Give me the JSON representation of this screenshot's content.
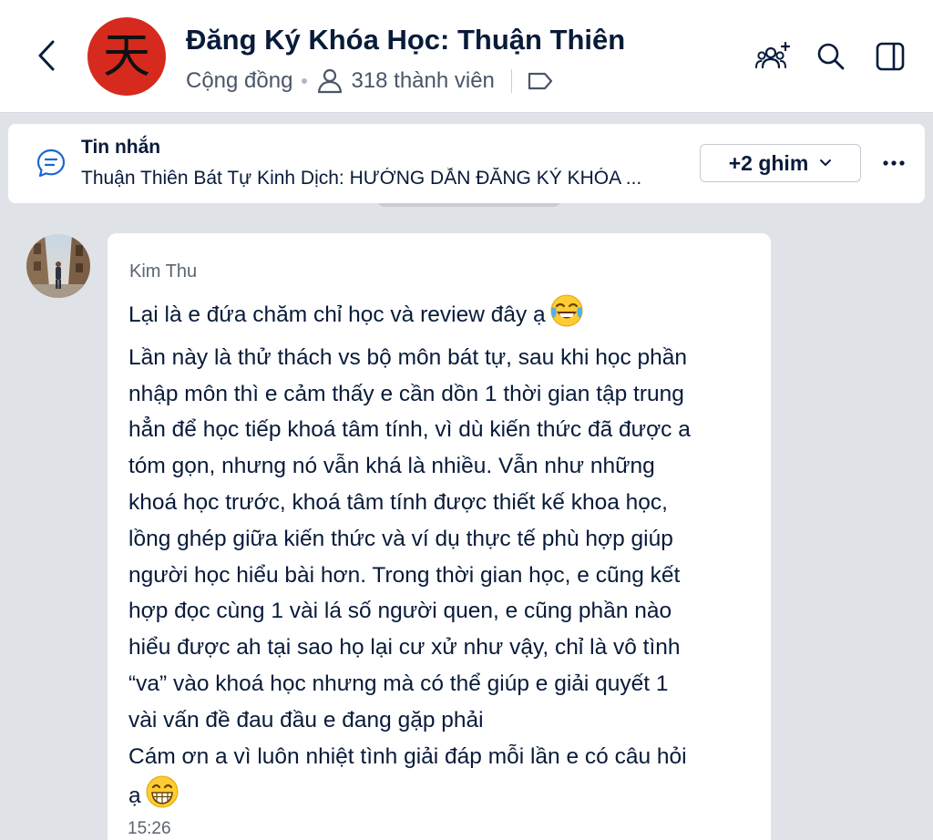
{
  "header": {
    "logo_char": "天",
    "title": "Đăng Ký Khóa Học: Thuận Thiên",
    "community_label": "Cộng đồng",
    "member_count": "318 thành viên",
    "icons": [
      "back-chevron-icon",
      "add-members-icon",
      "search-icon",
      "sidebar-toggle-icon",
      "tag-icon",
      "person-icon"
    ]
  },
  "pinned": {
    "title": "Tin nhắn",
    "text": "Thuận Thiên Bát Tự Kinh Dịch: HƯỚNG DẪN ĐĂNG KÝ KHÓA ...",
    "pins_button": "+2 ghim",
    "more_icon": "more-horizontal-icon"
  },
  "message": {
    "sender": "Kim Thu",
    "lines": [
      "Lại là e đứa chăm chỉ học và review đây ạ",
      "Lần này là thử thách vs bộ môn bát tự, sau khi học phần",
      "nhập môn thì e cảm thấy e cần dồn 1 thời gian tập trung",
      "hẳn để học tiếp khoá tâm tính, vì dù kiến thức đã được a",
      "tóm gọn, nhưng nó vẫn khá là nhiều. Vẫn như những",
      "khoá học trước, khoá tâm tính được thiết kế khoa học,",
      "lồng ghép giữa kiến thức và ví dụ thực tế phù hợp giúp",
      "người học hiểu bài hơn. Trong thời gian học, e cũng kết",
      "hợp đọc cùng 1 vài lá số người quen, e cũng phần nào",
      "hiểu được ah tại sao họ lại cư xử như vậy, chỉ là vô tình",
      "“va” vào khoá học nhưng mà có thể giúp e giải quyết 1",
      "vài vấn đề đau đầu e đang gặp phải",
      "Cám ơn a vì luôn nhiệt tình giải đáp mỗi lần e có câu hỏi",
      "ạ"
    ],
    "emojis": [
      "tears-of-joy-emoji",
      "grinning-emoji"
    ],
    "time": "15:26"
  },
  "colors": {
    "background": "#dfe2e7",
    "text": "#081b3a",
    "logo_red": "#d62a1e"
  }
}
